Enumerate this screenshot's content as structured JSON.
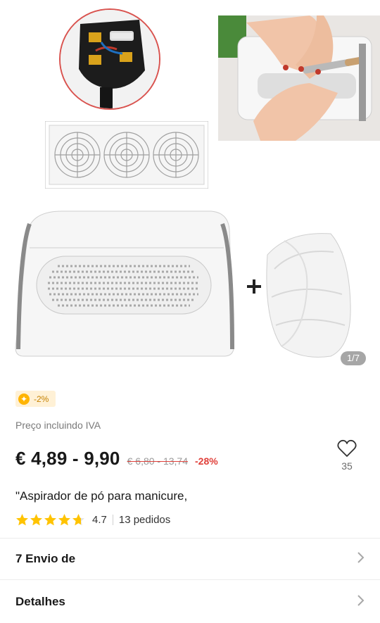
{
  "gallery": {
    "counter": "1/7",
    "plus_sign": "+"
  },
  "coupon": {
    "icon": "coin-icon",
    "text": "-2%"
  },
  "vat_note": "Preço incluindo IVA",
  "price": {
    "current": "€ 4,89 - 9,90",
    "original": "€ 6,80 - 13,74",
    "discount": "-28%"
  },
  "wishlist": {
    "icon": "heart-outline-icon",
    "count": "35"
  },
  "product_title": "\"Aspirador de pó para manicure,",
  "rating": {
    "stars": 4.7,
    "value": "4.7",
    "orders": "13 pedidos"
  },
  "rows": {
    "shipping": "7 Envio de",
    "details": "Detalhes"
  },
  "colors": {
    "star": "#ffc300",
    "discount": "#e0403a",
    "coupon_bg": "#fff1d6",
    "coupon_text": "#c58100"
  }
}
